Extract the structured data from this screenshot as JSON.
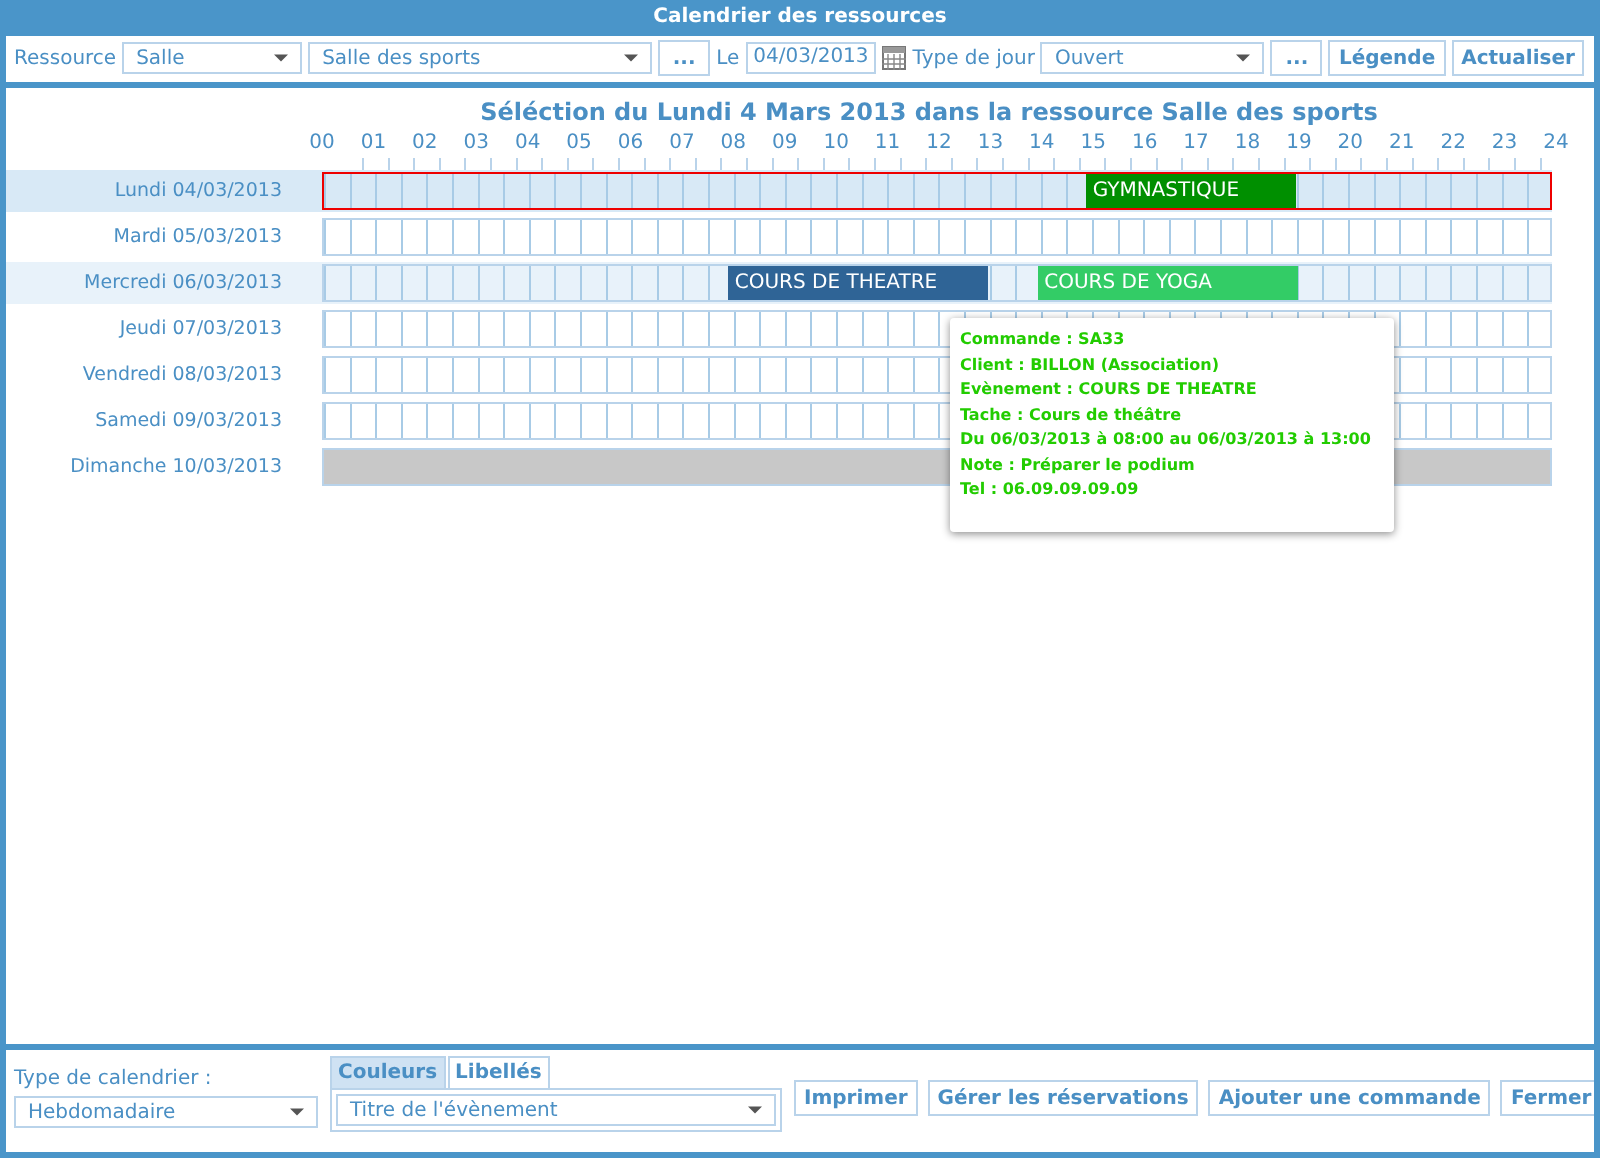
{
  "window": {
    "title": "Calendrier des ressources"
  },
  "toolbar": {
    "resource_label": "Ressource",
    "resource_type": "Salle",
    "resource": "Salle des sports",
    "more_button": "...",
    "date_label": "Le",
    "date": "04/03/2013",
    "day_type_label": "Type de jour",
    "day_type": "Ouvert",
    "more_button_2": "...",
    "legend_button": "Légende",
    "refresh_button": "Actualiser"
  },
  "heading": "Séléction du Lundi 4 Mars 2013 dans la ressource Salle des sports",
  "hours": [
    "00",
    "01",
    "02",
    "03",
    "04",
    "05",
    "06",
    "07",
    "08",
    "09",
    "10",
    "11",
    "12",
    "13",
    "14",
    "15",
    "16",
    "17",
    "18",
    "19",
    "20",
    "21",
    "22",
    "23",
    "24"
  ],
  "days": [
    {
      "label": "Lundi 04/03/2013",
      "selected": true,
      "highlighted": true,
      "closed": false,
      "slots": [
        {
          "kind": "free"
        },
        {
          "kind": "free"
        },
        {
          "kind": "free"
        },
        {
          "kind": "free"
        },
        {
          "kind": "free"
        },
        {
          "kind": "free"
        },
        {
          "kind": "free"
        },
        {
          "kind": "free"
        },
        {
          "kind": "free"
        },
        {
          "kind": "free"
        },
        {
          "kind": "free"
        },
        {
          "kind": "free"
        },
        {
          "kind": "free"
        },
        {
          "kind": "free"
        },
        {
          "kind": "free"
        },
        {
          "kind": "event",
          "title": "GYMNASTIQUE",
          "color": "#008f00"
        },
        {
          "kind": "cont"
        },
        {
          "kind": "cont"
        },
        {
          "kind": "cont"
        },
        {
          "kind": "free"
        },
        {
          "kind": "free"
        },
        {
          "kind": "free"
        },
        {
          "kind": "free"
        },
        {
          "kind": "free"
        }
      ]
    },
    {
      "label": "Mardi 05/03/2013",
      "selected": false,
      "highlighted": false,
      "closed": false
    },
    {
      "label": "Mercredi 06/03/2013",
      "selected": false,
      "highlighted": true,
      "closed": false,
      "slots": [
        {
          "kind": "free"
        },
        {
          "kind": "free"
        },
        {
          "kind": "free"
        },
        {
          "kind": "free"
        },
        {
          "kind": "free"
        },
        {
          "kind": "free"
        },
        {
          "kind": "free"
        },
        {
          "kind": "free"
        },
        {
          "kind": "event",
          "title": "COURS DE THEATRE",
          "color": "#2f6496"
        },
        {
          "kind": "cont"
        },
        {
          "kind": "cont"
        },
        {
          "kind": "cont"
        },
        {
          "kind": "cont"
        },
        {
          "kind": "free"
        },
        {
          "kind": "event",
          "title": "COURS DE YOGA",
          "color": "#33cc66"
        },
        {
          "kind": "cont"
        },
        {
          "kind": "cont"
        },
        {
          "kind": "cont"
        },
        {
          "kind": "cont"
        },
        {
          "kind": "free"
        },
        {
          "kind": "free"
        },
        {
          "kind": "free"
        },
        {
          "kind": "free"
        },
        {
          "kind": "free"
        }
      ]
    },
    {
      "label": "Jeudi 07/03/2013",
      "selected": false,
      "highlighted": false,
      "closed": false
    },
    {
      "label": "Vendredi 08/03/2013",
      "selected": false,
      "highlighted": false,
      "closed": false
    },
    {
      "label": "Samedi 09/03/2013",
      "selected": false,
      "highlighted": false,
      "closed": false
    },
    {
      "label": "Dimanche 10/03/2013",
      "selected": false,
      "highlighted": false,
      "closed": true
    }
  ],
  "tooltip": [
    "Commande : SA33",
    "Client : BILLON (Association)",
    "Evènement : COURS DE THEATRE",
    "Tache : Cours de théâtre",
    "Du 06/03/2013 à 08:00 au 06/03/2013 à 13:00",
    "Note : Préparer le podium",
    "Tel : 06.09.09.09.09"
  ],
  "footer": {
    "calendar_type_label": "Type de calendrier :",
    "calendar_type": "Hebdomadaire",
    "tabs": [
      {
        "label": "Couleurs",
        "selected": true
      },
      {
        "label": "Libellés",
        "selected": false
      }
    ],
    "label_field": "Titre de l'évènement",
    "buttons": [
      "Imprimer",
      "Gérer les réservations",
      "Ajouter une commande",
      "Fermer"
    ]
  }
}
